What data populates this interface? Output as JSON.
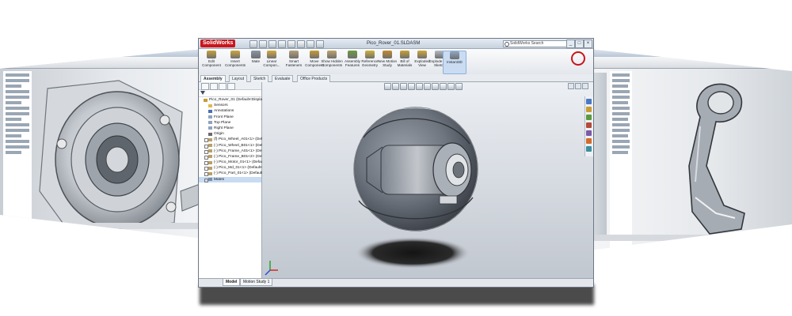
{
  "main_window": {
    "app_logo": "SolidWorks",
    "title": "Pico_Rover_01.SLDASM",
    "search_placeholder": "SolidWorks Search",
    "window_controls": [
      "_",
      "□",
      "×"
    ],
    "ribbon": [
      {
        "icon": "edit-component-icon",
        "label": "Edit Component",
        "color": "#c8a236"
      },
      {
        "icon": "insert-components-icon",
        "label": "Insert Components",
        "color": "#d0a73c"
      },
      {
        "icon": "mate-icon",
        "label": "Mate",
        "color": "#8a97a6"
      },
      {
        "icon": "linear-component-pattern-icon",
        "label": "Linear Compon...",
        "color": "#d5ab3d"
      },
      {
        "icon": "smart-fasteners-icon",
        "label": "Smart Fasteners",
        "color": "#b7a07a"
      },
      {
        "icon": "move-component-icon",
        "label": "Move Component",
        "color": "#c99c34"
      },
      {
        "icon": "show-hidden-components-icon",
        "label": "Show Hidden Components",
        "color": "#bfa46a"
      },
      {
        "icon": "assembly-features-icon",
        "label": "Assembly Features",
        "color": "#6b9b3f"
      },
      {
        "icon": "reference-geometry-icon",
        "label": "Reference Geometry",
        "color": "#d0b23a"
      },
      {
        "icon": "new-motion-study-icon",
        "label": "New Motion Study",
        "color": "#c58a2e"
      },
      {
        "icon": "bill-of-materials-icon",
        "label": "Bill of Materials",
        "color": "#c9a235"
      },
      {
        "icon": "exploded-view-icon",
        "label": "Exploded View",
        "color": "#d1a83a"
      },
      {
        "icon": "explode-line-sketch-icon",
        "label": "Explode Line Sketch",
        "color": "#b5bcc6"
      },
      {
        "icon": "instant3d-icon",
        "label": "Instant3D",
        "color": "#8fa7c4"
      }
    ],
    "tabs": [
      "Assembly",
      "Layout",
      "Sketch",
      "Evaluate",
      "Office Products"
    ],
    "feature_tree": [
      {
        "label": "Pico_Rover_01 (Default<Display S",
        "icon": "assembly-icon",
        "indent": 0,
        "expander": false,
        "selected": false
      },
      {
        "label": "Sensors",
        "icon": "folder-icon",
        "indent": 1,
        "expander": false,
        "selected": false
      },
      {
        "label": "Annotations",
        "icon": "annotations-icon",
        "indent": 1,
        "expander": false,
        "selected": false
      },
      {
        "label": "Front Plane",
        "icon": "plane-icon",
        "indent": 1,
        "expander": false,
        "selected": false
      },
      {
        "label": "Top Plane",
        "icon": "plane-icon",
        "indent": 1,
        "expander": false,
        "selected": false
      },
      {
        "label": "Right Plane",
        "icon": "plane-icon",
        "indent": 1,
        "expander": false,
        "selected": false
      },
      {
        "label": "Origin",
        "icon": "origin-icon",
        "indent": 1,
        "expander": false,
        "selected": false
      },
      {
        "label": "(f) Pico_Wheel_A01<1> (Defaul",
        "icon": "part-icon",
        "indent": 1,
        "expander": true,
        "selected": false
      },
      {
        "label": "(-) Pico_Wheel_B01<1> (Defaul",
        "icon": "part-icon",
        "indent": 1,
        "expander": true,
        "selected": false
      },
      {
        "label": "(-) Pico_Frame_A01<1> (Defaul",
        "icon": "part-icon",
        "indent": 1,
        "expander": true,
        "selected": false
      },
      {
        "label": "(-) Pico_Frame_B01<2> (Defaul",
        "icon": "part-icon",
        "indent": 1,
        "expander": true,
        "selected": false
      },
      {
        "label": "(-) Pico_Motor_01<1> (Default",
        "icon": "part-icon",
        "indent": 1,
        "expander": true,
        "selected": false
      },
      {
        "label": "(-) Pico_Md_01<1> (Default<<",
        "icon": "part-icon",
        "indent": 1,
        "expander": true,
        "selected": false
      },
      {
        "label": "(-) Pico_Part_01<1> (Default<<",
        "icon": "part-icon",
        "indent": 1,
        "expander": true,
        "selected": false
      },
      {
        "label": "Mates",
        "icon": "mates-icon",
        "indent": 1,
        "expander": true,
        "selected": true
      }
    ],
    "bottom_tabs": [
      "Model",
      "Motion Study 1"
    ]
  }
}
